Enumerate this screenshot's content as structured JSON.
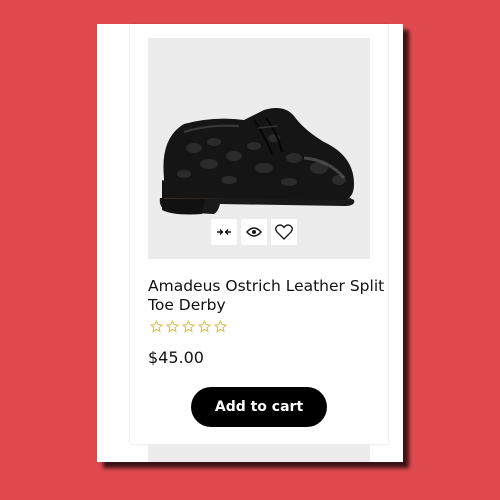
{
  "colors": {
    "background": "#e04a4f",
    "card": "#ffffff",
    "image_bg": "#ececec",
    "button": "#000000",
    "star": "#d9b84a"
  },
  "product": {
    "title": "Amadeus Ostrich Leather Split Toe Derby",
    "price": "$45.00",
    "rating": {
      "value": 0,
      "max": 5
    },
    "add_to_cart_label": "Add to cart",
    "image_icon": "black-leather-derby-shoe",
    "actions": [
      {
        "icon": "compare-arrows-icon"
      },
      {
        "icon": "eye-icon"
      },
      {
        "icon": "heart-icon"
      }
    ]
  }
}
